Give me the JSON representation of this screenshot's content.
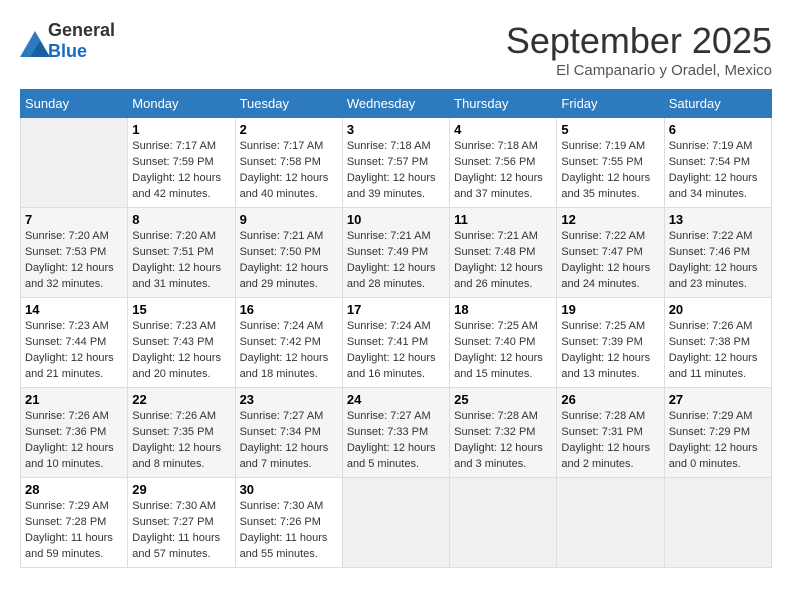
{
  "logo": {
    "text1": "General",
    "text2": "Blue"
  },
  "title": "September 2025",
  "location": "El Campanario y Oradel, Mexico",
  "days_header": [
    "Sunday",
    "Monday",
    "Tuesday",
    "Wednesday",
    "Thursday",
    "Friday",
    "Saturday"
  ],
  "weeks": [
    [
      {
        "num": "",
        "info": ""
      },
      {
        "num": "1",
        "info": "Sunrise: 7:17 AM\nSunset: 7:59 PM\nDaylight: 12 hours\nand 42 minutes."
      },
      {
        "num": "2",
        "info": "Sunrise: 7:17 AM\nSunset: 7:58 PM\nDaylight: 12 hours\nand 40 minutes."
      },
      {
        "num": "3",
        "info": "Sunrise: 7:18 AM\nSunset: 7:57 PM\nDaylight: 12 hours\nand 39 minutes."
      },
      {
        "num": "4",
        "info": "Sunrise: 7:18 AM\nSunset: 7:56 PM\nDaylight: 12 hours\nand 37 minutes."
      },
      {
        "num": "5",
        "info": "Sunrise: 7:19 AM\nSunset: 7:55 PM\nDaylight: 12 hours\nand 35 minutes."
      },
      {
        "num": "6",
        "info": "Sunrise: 7:19 AM\nSunset: 7:54 PM\nDaylight: 12 hours\nand 34 minutes."
      }
    ],
    [
      {
        "num": "7",
        "info": "Sunrise: 7:20 AM\nSunset: 7:53 PM\nDaylight: 12 hours\nand 32 minutes."
      },
      {
        "num": "8",
        "info": "Sunrise: 7:20 AM\nSunset: 7:51 PM\nDaylight: 12 hours\nand 31 minutes."
      },
      {
        "num": "9",
        "info": "Sunrise: 7:21 AM\nSunset: 7:50 PM\nDaylight: 12 hours\nand 29 minutes."
      },
      {
        "num": "10",
        "info": "Sunrise: 7:21 AM\nSunset: 7:49 PM\nDaylight: 12 hours\nand 28 minutes."
      },
      {
        "num": "11",
        "info": "Sunrise: 7:21 AM\nSunset: 7:48 PM\nDaylight: 12 hours\nand 26 minutes."
      },
      {
        "num": "12",
        "info": "Sunrise: 7:22 AM\nSunset: 7:47 PM\nDaylight: 12 hours\nand 24 minutes."
      },
      {
        "num": "13",
        "info": "Sunrise: 7:22 AM\nSunset: 7:46 PM\nDaylight: 12 hours\nand 23 minutes."
      }
    ],
    [
      {
        "num": "14",
        "info": "Sunrise: 7:23 AM\nSunset: 7:44 PM\nDaylight: 12 hours\nand 21 minutes."
      },
      {
        "num": "15",
        "info": "Sunrise: 7:23 AM\nSunset: 7:43 PM\nDaylight: 12 hours\nand 20 minutes."
      },
      {
        "num": "16",
        "info": "Sunrise: 7:24 AM\nSunset: 7:42 PM\nDaylight: 12 hours\nand 18 minutes."
      },
      {
        "num": "17",
        "info": "Sunrise: 7:24 AM\nSunset: 7:41 PM\nDaylight: 12 hours\nand 16 minutes."
      },
      {
        "num": "18",
        "info": "Sunrise: 7:25 AM\nSunset: 7:40 PM\nDaylight: 12 hours\nand 15 minutes."
      },
      {
        "num": "19",
        "info": "Sunrise: 7:25 AM\nSunset: 7:39 PM\nDaylight: 12 hours\nand 13 minutes."
      },
      {
        "num": "20",
        "info": "Sunrise: 7:26 AM\nSunset: 7:38 PM\nDaylight: 12 hours\nand 11 minutes."
      }
    ],
    [
      {
        "num": "21",
        "info": "Sunrise: 7:26 AM\nSunset: 7:36 PM\nDaylight: 12 hours\nand 10 minutes."
      },
      {
        "num": "22",
        "info": "Sunrise: 7:26 AM\nSunset: 7:35 PM\nDaylight: 12 hours\nand 8 minutes."
      },
      {
        "num": "23",
        "info": "Sunrise: 7:27 AM\nSunset: 7:34 PM\nDaylight: 12 hours\nand 7 minutes."
      },
      {
        "num": "24",
        "info": "Sunrise: 7:27 AM\nSunset: 7:33 PM\nDaylight: 12 hours\nand 5 minutes."
      },
      {
        "num": "25",
        "info": "Sunrise: 7:28 AM\nSunset: 7:32 PM\nDaylight: 12 hours\nand 3 minutes."
      },
      {
        "num": "26",
        "info": "Sunrise: 7:28 AM\nSunset: 7:31 PM\nDaylight: 12 hours\nand 2 minutes."
      },
      {
        "num": "27",
        "info": "Sunrise: 7:29 AM\nSunset: 7:29 PM\nDaylight: 12 hours\nand 0 minutes."
      }
    ],
    [
      {
        "num": "28",
        "info": "Sunrise: 7:29 AM\nSunset: 7:28 PM\nDaylight: 11 hours\nand 59 minutes."
      },
      {
        "num": "29",
        "info": "Sunrise: 7:30 AM\nSunset: 7:27 PM\nDaylight: 11 hours\nand 57 minutes."
      },
      {
        "num": "30",
        "info": "Sunrise: 7:30 AM\nSunset: 7:26 PM\nDaylight: 11 hours\nand 55 minutes."
      },
      {
        "num": "",
        "info": ""
      },
      {
        "num": "",
        "info": ""
      },
      {
        "num": "",
        "info": ""
      },
      {
        "num": "",
        "info": ""
      }
    ]
  ]
}
